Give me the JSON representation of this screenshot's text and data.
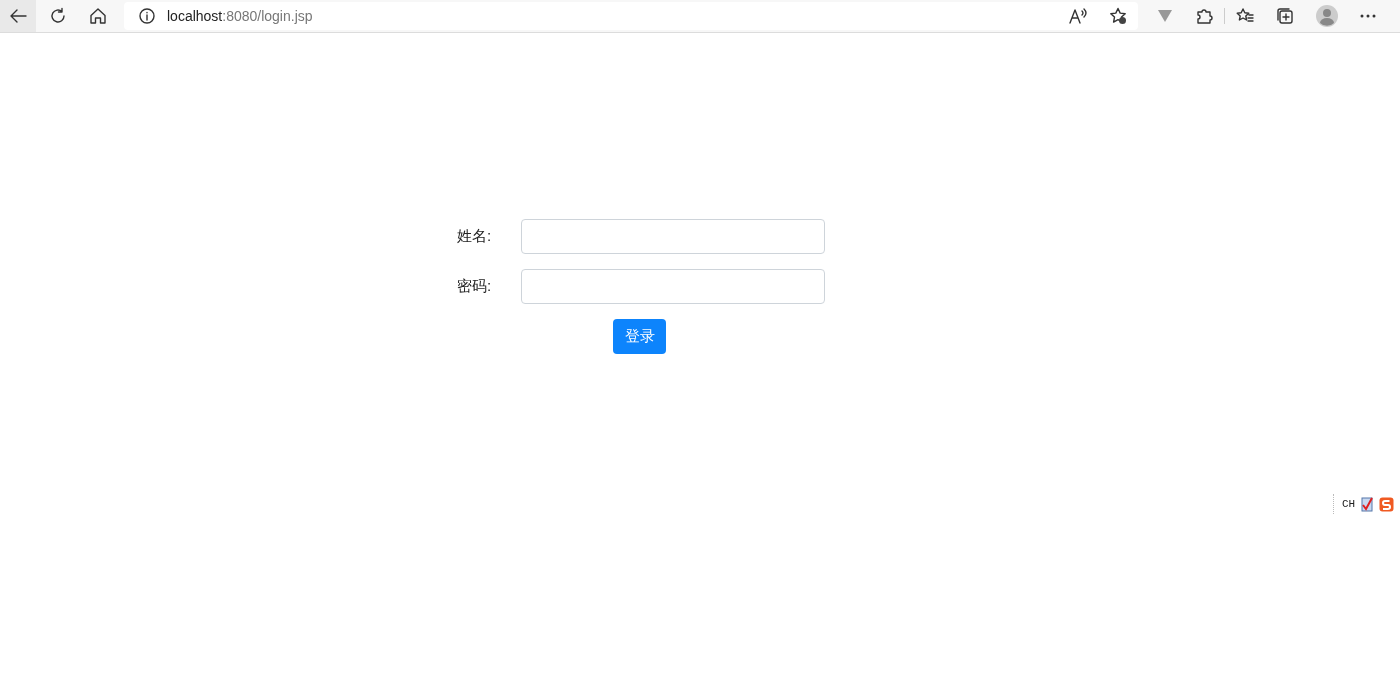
{
  "browser": {
    "url_host": "localhost",
    "url_path": ":8080/login.jsp"
  },
  "form": {
    "fields": [
      {
        "label": "姓名:"
      },
      {
        "label": "密码:"
      }
    ],
    "submit": "登录"
  },
  "ime_bar": {
    "language": "CH"
  }
}
